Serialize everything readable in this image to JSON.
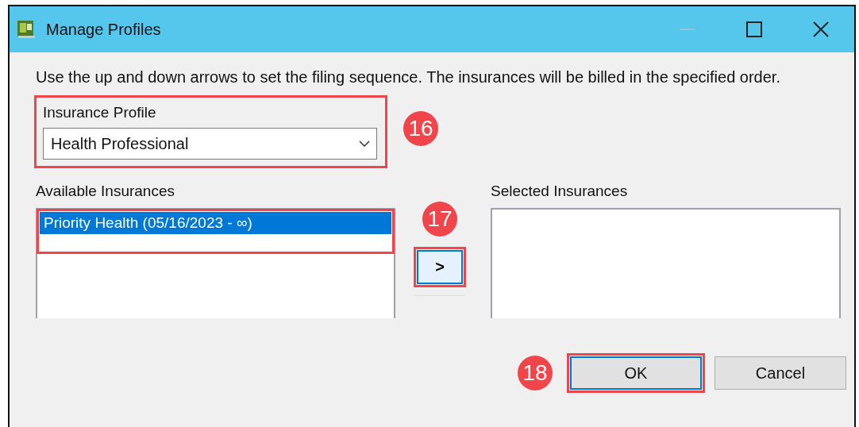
{
  "window": {
    "title": "Manage Profiles"
  },
  "instructions": "Use the up and down arrows to set the filing sequence. The insurances will be billed in the specified order.",
  "profile": {
    "label": "Insurance Profile",
    "value": "Health Professional",
    "highlighted": true,
    "callout": "16"
  },
  "available": {
    "label": "Available Insurances",
    "items": [
      {
        "text": "Priority Health (05/16/2023 - ∞)",
        "selected": true,
        "highlighted": true
      }
    ],
    "callout": "17"
  },
  "add_button": {
    "label": ">",
    "highlighted": true
  },
  "selected": {
    "label": "Selected Insurances"
  },
  "buttons": [
    {
      "label": "OK",
      "default": true,
      "highlighted": true,
      "callout": "18"
    },
    {
      "label": "Cancel",
      "default": false,
      "highlighted": false
    }
  ]
}
